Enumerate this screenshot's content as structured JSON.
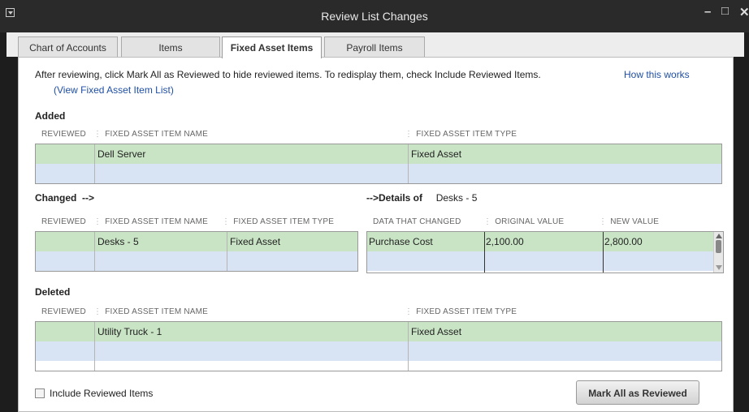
{
  "window": {
    "title": "Review List Changes"
  },
  "tabs": [
    {
      "label": "Chart of Accounts"
    },
    {
      "label": "Items"
    },
    {
      "label": "Fixed Asset Items"
    },
    {
      "label": "Payroll Items"
    }
  ],
  "info": {
    "text": "After reviewing, click Mark All as Reviewed to hide reviewed items. To redisplay them, check Include Reviewed Items.",
    "view_link": "(View Fixed Asset Item List)",
    "how_link": "How this works"
  },
  "added": {
    "title": "Added",
    "columns": [
      "REVIEWED",
      "FIXED ASSET ITEM NAME",
      "FIXED ASSET ITEM TYPE"
    ],
    "rows": [
      {
        "reviewed": "",
        "name": "Dell Server",
        "type": "Fixed Asset"
      }
    ]
  },
  "changed": {
    "title": "Changed",
    "arrow": "-->",
    "columns": [
      "REVIEWED",
      "FIXED ASSET ITEM NAME",
      "FIXED ASSET ITEM TYPE"
    ],
    "rows": [
      {
        "reviewed": "",
        "name": "Desks - 5",
        "type": "Fixed Asset"
      }
    ]
  },
  "details": {
    "label": "-->Details of",
    "item": "Desks - 5",
    "columns": [
      "DATA THAT CHANGED",
      "ORIGINAL VALUE",
      "NEW VALUE"
    ],
    "rows": [
      {
        "data": "Purchase Cost",
        "original": "2,100.00",
        "new": "2,800.00"
      }
    ]
  },
  "deleted": {
    "title": "Deleted",
    "columns": [
      "REVIEWED",
      "FIXED ASSET ITEM NAME",
      "FIXED ASSET ITEM TYPE"
    ],
    "rows": [
      {
        "reviewed": "",
        "name": "Utility Truck - 1",
        "type": "Fixed Asset"
      }
    ]
  },
  "footer": {
    "include_reviewed_label": "Include Reviewed Items",
    "include_reviewed_checked": false,
    "mark_all_label": "Mark All as Reviewed"
  },
  "colors": {
    "row_green": "#c9e4c5",
    "row_blue": "#d8e3f4",
    "link": "#1f4fa5",
    "titlebar": "#2a2a2a"
  }
}
